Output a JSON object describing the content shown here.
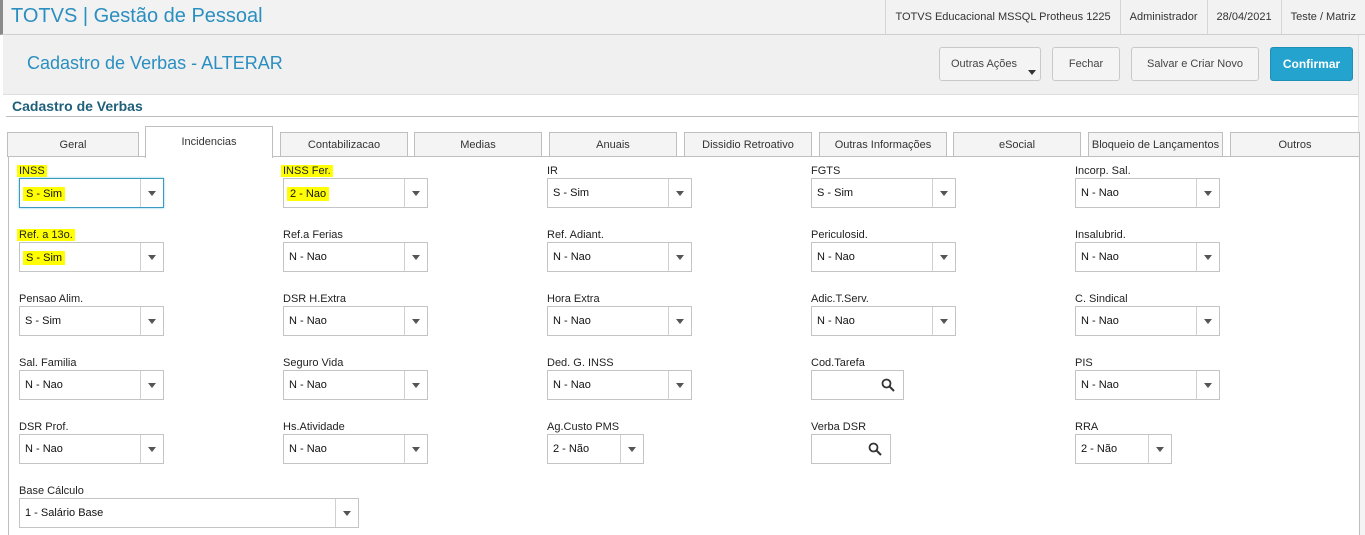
{
  "app": {
    "title": "TOTVS | Gestão de Pessoal",
    "environment": "TOTVS Educacional MSSQL Protheus 1225",
    "user": "Administrador",
    "date": "28/04/2021",
    "company": "Teste / Matriz"
  },
  "page": {
    "title": "Cadastro de Verbas - ALTERAR",
    "section_title": "Cadastro de Verbas"
  },
  "toolbar": {
    "more_label": "Outras Ações",
    "close_label": "Fechar",
    "save_new_label": "Salvar e Criar Novo",
    "confirm_label": "Confirmar"
  },
  "tabs": [
    {
      "label": "Geral"
    },
    {
      "label": "Incidencias"
    },
    {
      "label": "Contabilizacao"
    },
    {
      "label": "Medias"
    },
    {
      "label": "Anuais"
    },
    {
      "label": "Dissidio Retroativo"
    },
    {
      "label": "Outras Informações"
    },
    {
      "label": "eSocial"
    },
    {
      "label": "Bloqueio de Lançamentos"
    },
    {
      "label": "Outros"
    }
  ],
  "fields": [
    {
      "label": "INSS",
      "value": "S - Sim"
    },
    {
      "label": "INSS Fer.",
      "value": "2 - Nao"
    },
    {
      "label": "IR",
      "value": "S - Sim"
    },
    {
      "label": "FGTS",
      "value": "S - Sim"
    },
    {
      "label": "Incorp. Sal.",
      "value": "N - Nao"
    },
    {
      "label": "Ref. a 13o.",
      "value": "S - Sim"
    },
    {
      "label": "Ref.a Ferias",
      "value": "N - Nao"
    },
    {
      "label": "Ref. Adiant.",
      "value": "N - Nao"
    },
    {
      "label": "Periculosid.",
      "value": "N - Nao"
    },
    {
      "label": "Insalubrid.",
      "value": "N - Nao"
    },
    {
      "label": "Pensao Alim.",
      "value": "S - Sim"
    },
    {
      "label": "DSR H.Extra",
      "value": "N - Nao"
    },
    {
      "label": "Hora Extra",
      "value": "N - Nao"
    },
    {
      "label": "Adic.T.Serv.",
      "value": "N - Nao"
    },
    {
      "label": "C. Sindical",
      "value": "N - Nao"
    },
    {
      "label": "Sal. Familia",
      "value": "N - Nao"
    },
    {
      "label": "Seguro Vida",
      "value": "N - Nao"
    },
    {
      "label": "Ded. G. INSS",
      "value": "N - Nao"
    },
    {
      "label": "Cod.Tarefa",
      "value": ""
    },
    {
      "label": "PIS",
      "value": "N - Nao"
    },
    {
      "label": "DSR Prof.",
      "value": "N - Nao"
    },
    {
      "label": "Hs.Atividade",
      "value": "N - Nao"
    },
    {
      "label": "Ag.Custo PMS",
      "value": "2 - Não"
    },
    {
      "label": "Verba DSR",
      "value": ""
    },
    {
      "label": "RRA",
      "value": "2 - Não"
    },
    {
      "label": "Base Cálculo",
      "value": "1 - Salário Base"
    }
  ]
}
